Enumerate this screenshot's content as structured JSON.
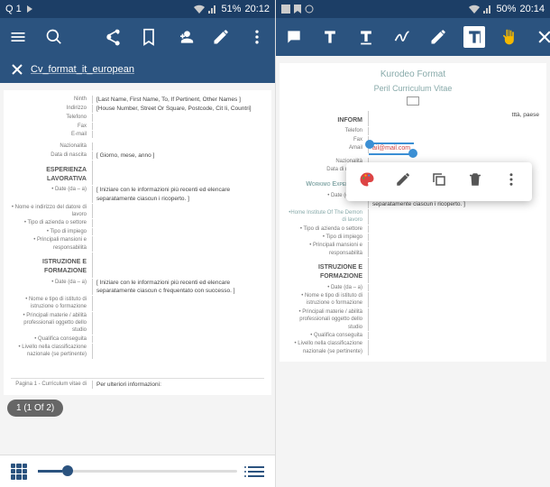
{
  "left": {
    "status": {
      "left_text": "Q 1",
      "battery": "51%",
      "time": "20:12"
    },
    "tab": {
      "file_name": "Cv_format_it_european"
    },
    "doc": {
      "labels": {
        "ninth": "Ninth",
        "indirizzo": "Indirizzo",
        "telefono": "Telefono",
        "fax": "Fax",
        "email": "E-mail",
        "naz": "Nazionalità",
        "dob": "Data di nascita"
      },
      "placeholders": {
        "name": "[Last Name, First Name, To, If Pertinent, Other Names ]",
        "address": "[House Number, Street Or Square, Postcode, Cit Ii, Countri]",
        "dob": "[ Giorno, mese, anno ]"
      },
      "section_work": "ESPERIENZA LAVORATIVA",
      "section_edu": "ISTRUZIONE E FORMAZIONE",
      "work_fields": {
        "date": "• Date (da – a)",
        "employer": "• Nome e indirizzo del datore di lavoro",
        "company_type": "• Tipo di azienda o settore",
        "job_type": "• Tipo di impiego",
        "duties": "• Principali mansioni e responsabilità"
      },
      "work_placeholder": "[ Iniziare con le informazioni più recenti ed elencare separatamente ciascun i ricoperto. ]",
      "edu_fields": {
        "date": "• Date (da – a)",
        "inst": "• Nome e tipo di istituto di istruzione o formazione",
        "subjects": "• Principali materie / abilità professionali oggetto dello studio",
        "qual": "• Qualifica conseguita",
        "level": "• Livello nella classificazione nazionale (se pertinente)"
      },
      "edu_placeholder": "[ Iniziare con le informazioni più recenti ed elencare separatamente ciascun c frequentato con successo. ]",
      "footer_left": "Pagina 1 - Curriculum vitae di",
      "footer_right": "Per ulteriori informazioni:"
    },
    "page_indicator": "1 (1 Of 2)"
  },
  "right": {
    "status": {
      "battery": "50%",
      "time": "20:14"
    },
    "doc": {
      "title_1": "Kurodeo Format",
      "title_2": "Peril Curriculum Vitae",
      "section_info": "INFORM",
      "labels": {
        "telefon": "Telefon",
        "fax": "Fax",
        "amail": "Amail",
        "naz": "Nazionalità",
        "dob": "Data di nascita"
      },
      "selected_text": "ail@mail.com",
      "section_work": "Workimo Experience",
      "section_edu": "ISTRUZIONE E FORMAZIONE",
      "visible_text": "tttà, paese",
      "work_fields": {
        "date": "• Date (da – a)",
        "employer": "•Home Institute Of The Demon di lavoro",
        "company_type": "• Tipo di azienda o settore",
        "job_type": "• Tipo di impiego",
        "duties": "• Principali mansioni e responsabilità"
      },
      "work_placeholder": "[ Iniziare con le informazioni più recenti ed elencare separatamente ciascun i ricoperto. ]",
      "edu_fields": {
        "date": "• Date (da – a)",
        "inst": "• Nome e tipo di istituto di istruzione o formazione",
        "subjects": "• Principali materie / abilità professionali oggetto dello studio",
        "qual": "• Qualifica conseguita",
        "level": "• Livello nella classificazione nazionale (se pertinente)"
      }
    }
  }
}
